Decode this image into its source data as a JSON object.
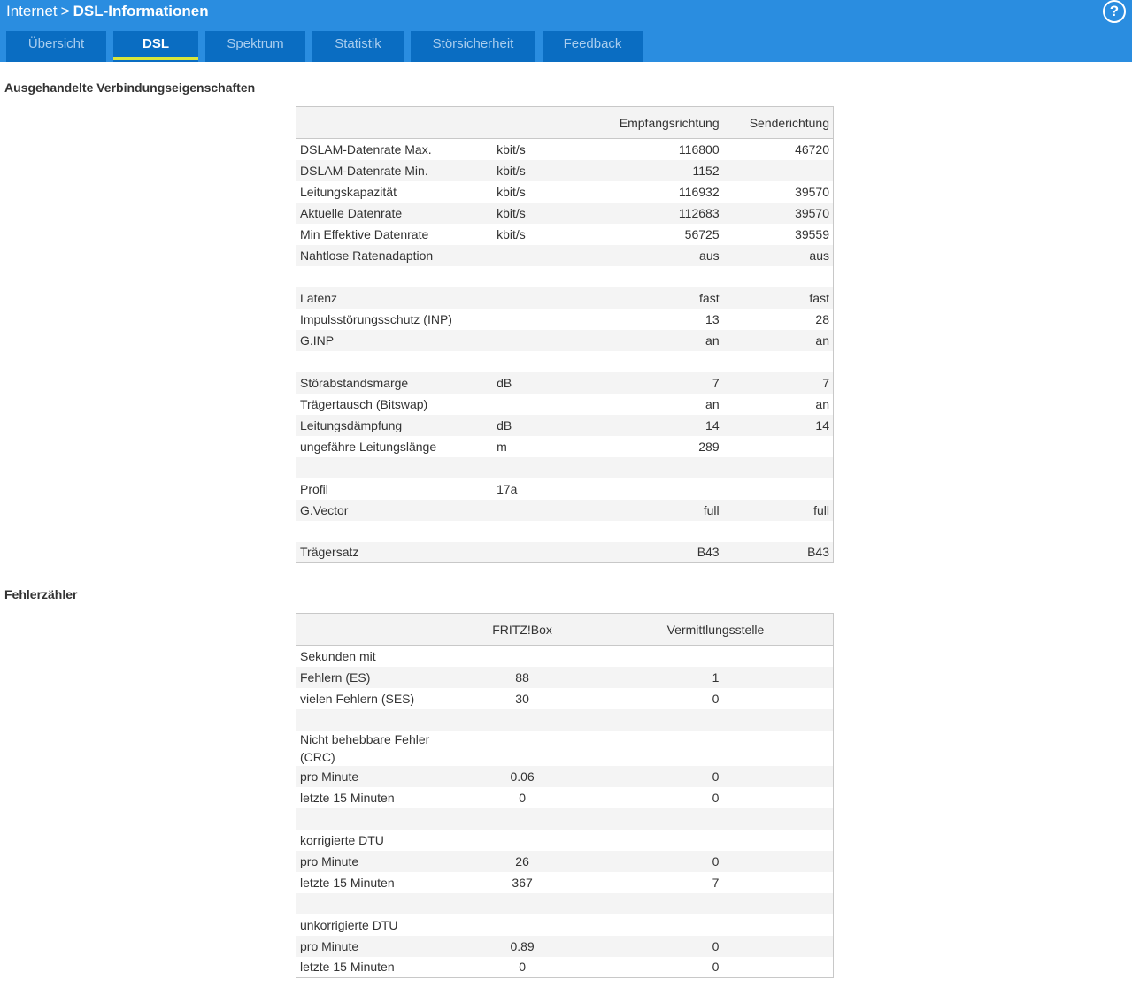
{
  "header": {
    "crumb_root": "Internet",
    "crumb_separator": ">",
    "crumb_page": "DSL-Informationen",
    "help_label": "?"
  },
  "tabs": [
    {
      "label": "Übersicht"
    },
    {
      "label": "DSL",
      "active": true
    },
    {
      "label": "Spektrum"
    },
    {
      "label": "Statistik"
    },
    {
      "label": "Störsicherheit"
    },
    {
      "label": "Feedback"
    }
  ],
  "section1": {
    "title": "Ausgehandelte Verbindungseigenschaften",
    "columns": [
      "",
      "",
      "Empfangsrichtung",
      "Senderichtung"
    ],
    "rows": [
      [
        "DSLAM-Datenrate Max.",
        "kbit/s",
        "116800",
        "46720"
      ],
      [
        "DSLAM-Datenrate Min.",
        "kbit/s",
        "1152",
        ""
      ],
      [
        "Leitungskapazität",
        "kbit/s",
        "116932",
        "39570"
      ],
      [
        "Aktuelle Datenrate",
        "kbit/s",
        "112683",
        "39570"
      ],
      [
        "Min Effektive Datenrate",
        "kbit/s",
        "56725",
        "39559"
      ],
      [
        "Nahtlose Ratenadaption",
        "",
        "aus",
        "aus"
      ],
      [
        "",
        "",
        "",
        ""
      ],
      [
        "Latenz",
        "",
        "fast",
        "fast"
      ],
      [
        "Impulsstörungsschutz (INP)",
        "",
        "13",
        "28"
      ],
      [
        "G.INP",
        "",
        "an",
        "an"
      ],
      [
        "",
        "",
        "",
        ""
      ],
      [
        "Störabstandsmarge",
        "dB",
        "7",
        "7"
      ],
      [
        "Trägertausch (Bitswap)",
        "",
        "an",
        "an"
      ],
      [
        "Leitungsdämpfung",
        "dB",
        "14",
        "14"
      ],
      [
        "ungefähre Leitungslänge",
        "m",
        "289",
        ""
      ],
      [
        "",
        "",
        "",
        ""
      ],
      [
        "Profil",
        "17a",
        "",
        ""
      ],
      [
        "G.Vector",
        "",
        "full",
        "full"
      ],
      [
        "",
        "",
        "",
        ""
      ],
      [
        "Trägersatz",
        "",
        "B43",
        "B43"
      ]
    ]
  },
  "section2": {
    "title": "Fehlerzähler",
    "columns": [
      "",
      "FRITZ!Box",
      "Vermittlungsstelle"
    ],
    "rows": [
      [
        "Sekunden mit",
        "",
        ""
      ],
      [
        "Fehlern (ES)",
        "88",
        "1"
      ],
      [
        "vielen Fehlern (SES)",
        "30",
        "0"
      ],
      [
        "",
        "",
        ""
      ],
      [
        "Nicht behebbare Fehler (CRC)",
        "",
        ""
      ],
      [
        "pro Minute",
        "0.06",
        "0"
      ],
      [
        "letzte 15 Minuten",
        "0",
        "0"
      ],
      [
        "",
        "",
        ""
      ],
      [
        "korrigierte DTU",
        "",
        ""
      ],
      [
        "pro Minute",
        "26",
        "0"
      ],
      [
        "letzte 15 Minuten",
        "367",
        "7"
      ],
      [
        "",
        "",
        ""
      ],
      [
        "unkorrigierte DTU",
        "",
        ""
      ],
      [
        "pro Minute",
        "0.89",
        "0"
      ],
      [
        "letzte 15 Minuten",
        "0",
        "0"
      ]
    ]
  }
}
